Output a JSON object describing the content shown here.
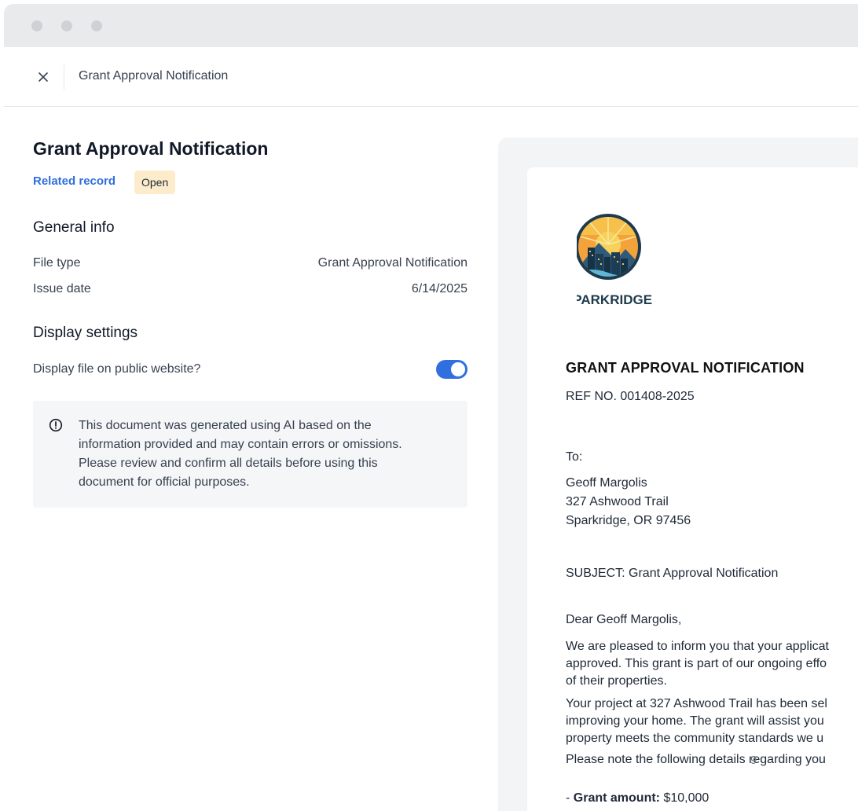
{
  "window": {
    "tab_title": "Grant Approval Notification"
  },
  "details": {
    "title": "Grant Approval Notification",
    "related_record_label": "Related record",
    "status_badge": "Open",
    "general_info": {
      "heading": "General info",
      "file_type_label": "File type",
      "file_type_value": "Grant Approval Notification",
      "issue_date_label": "Issue date",
      "issue_date_value": "6/14/2025"
    },
    "display_settings": {
      "heading": "Display settings",
      "public_label": "Display file on public website?",
      "public_enabled": true
    },
    "notice": {
      "icon": "info-circle-icon",
      "lines": [
        "This document was generated using AI based on the",
        "information provided and may contain errors or omissions.",
        "Please review and confirm all details before using this",
        "document for official purposes."
      ]
    }
  },
  "document": {
    "logo_text": "SPARKRIDGE",
    "heading": "GRANT APPROVAL NOTIFICATION",
    "ref_no": "REF NO. 001408-2025",
    "to_label": "To:",
    "recipient_name": "Geoff Margolis",
    "recipient_street": "327 Ashwood Trail",
    "recipient_city": "Sparkridge, OR 97456",
    "subject": "SUBJECT: Grant Approval Notification",
    "salutation": "Dear Geoff Margolis,",
    "para1": [
      "We are pleased to inform you that your applicat",
      "approved. This grant is part of our ongoing effo",
      "of their properties."
    ],
    "para2": [
      "Your project at 327 Ashwood Trail has been sel",
      "improving your home. The grant will assist you",
      "property meets the community standards we u"
    ],
    "para3": "Please note the following details regarding you",
    "page_number": "9",
    "grant_amount_label": "Grant amount:",
    "grant_amount_value": "$10,000",
    "bullet_prefix": "- "
  },
  "colors": {
    "accent": "#2f6fdf",
    "badge_bg": "#fdeccb"
  }
}
